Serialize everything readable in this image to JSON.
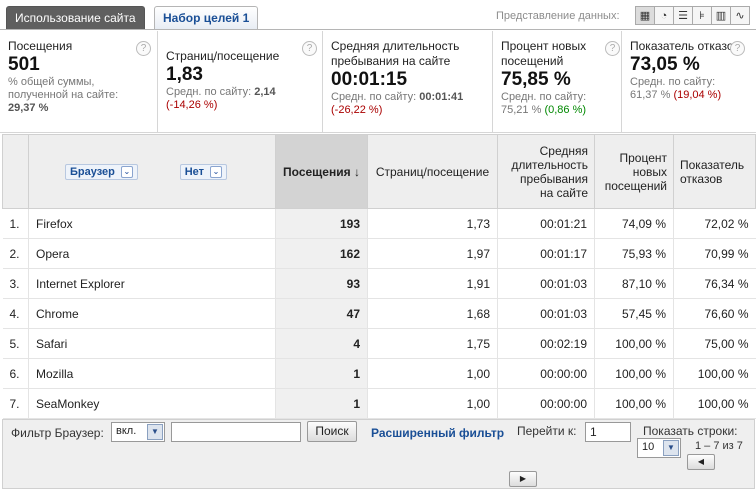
{
  "tabs": [
    {
      "label": "Использование сайта"
    },
    {
      "label": "Набор целей 1"
    }
  ],
  "view_label": "Представление данных:",
  "view_icons": [
    "table-view-icon",
    "pie-view-icon",
    "performance-view-icon",
    "comparison-view-icon",
    "pivot-view-icon",
    "sparkline-view-icon"
  ],
  "metrics": [
    {
      "title": "Посещения",
      "value": "501",
      "sub1": "% общей суммы, полученной на сайте:",
      "sub2": "29,37 %"
    },
    {
      "title": "Страниц/посещение",
      "value": "1,83",
      "sub1": "Средн. по сайту:",
      "avg": "2,14",
      "delta": "(-14,26 %)"
    },
    {
      "title": "Средняя длительность пребывания на сайте",
      "value": "00:01:15",
      "sub1": "Средн. по сайту:",
      "avg": "00:01:41",
      "delta": "(-26,22 %)"
    },
    {
      "title": "Процент новых посещений",
      "value": "75,85 %",
      "sub1": "Средн. по сайту:",
      "avg": "75,21 %",
      "delta": "(0,86 %)"
    },
    {
      "title": "Показатель отказов",
      "value": "73,05 %",
      "sub1": "Средн. по сайту:",
      "avg": "61,37 %",
      "delta": "(19,04 %)"
    }
  ],
  "help_glyph": "?",
  "table": {
    "dimension_label": "Браузер",
    "secondary_label": "Нет",
    "headers": [
      "Посещения",
      "Страниц/посещение",
      "Средняя длительность пребывания на сайте",
      "Процент новых посещений",
      "Показатель отказов"
    ],
    "sort_arrow": "↓",
    "rows": [
      {
        "n": "1.",
        "browser": "Firefox",
        "visits": "193",
        "ppv": "1,73",
        "dur": "00:01:21",
        "new": "74,09 %",
        "bounce": "72,02 %"
      },
      {
        "n": "2.",
        "browser": "Opera",
        "visits": "162",
        "ppv": "1,97",
        "dur": "00:01:17",
        "new": "75,93 %",
        "bounce": "70,99 %"
      },
      {
        "n": "3.",
        "browser": "Internet Explorer",
        "visits": "93",
        "ppv": "1,91",
        "dur": "00:01:03",
        "new": "87,10 %",
        "bounce": "76,34 %"
      },
      {
        "n": "4.",
        "browser": "Chrome",
        "visits": "47",
        "ppv": "1,68",
        "dur": "00:01:03",
        "new": "57,45 %",
        "bounce": "76,60 %"
      },
      {
        "n": "5.",
        "browser": "Safari",
        "visits": "4",
        "ppv": "1,75",
        "dur": "00:02:19",
        "new": "100,00 %",
        "bounce": "75,00 %"
      },
      {
        "n": "6.",
        "browser": "Mozilla",
        "visits": "1",
        "ppv": "1,00",
        "dur": "00:00:00",
        "new": "100,00 %",
        "bounce": "100,00 %"
      },
      {
        "n": "7.",
        "browser": "SeaMonkey",
        "visits": "1",
        "ppv": "1,00",
        "dur": "00:00:00",
        "new": "100,00 %",
        "bounce": "100,00 %"
      }
    ]
  },
  "footer": {
    "filter_label": "Фильтр Браузер:",
    "filter_mode": "вкл.",
    "filter_value": "",
    "search_button": "Поиск",
    "advanced_filter": "Расширенный фильтр",
    "goto_label": "Перейти к:",
    "goto_value": "1",
    "rows_label": "Показать строки:",
    "rows_value": "10",
    "range": "1 – 7 из 7",
    "prev": "◀",
    "next": "▶"
  },
  "colors": {
    "accent": "#1a4f96",
    "negative": "#aa0000",
    "positive": "#008800"
  }
}
